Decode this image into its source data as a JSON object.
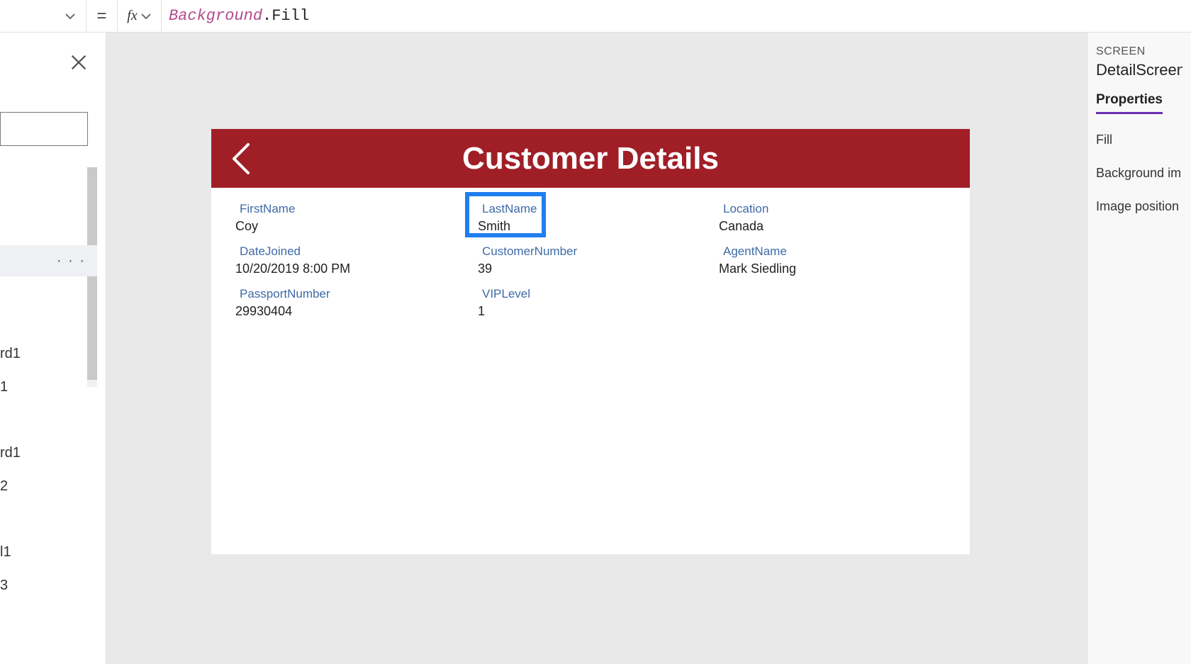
{
  "formula_bar": {
    "equals": "=",
    "fx": "fx",
    "identifier": "Background",
    "dot": ".",
    "property": "Fill"
  },
  "left_panel": {
    "selected_more": "· · ·",
    "items": [
      "rd1",
      "1",
      "rd1",
      "2",
      "l1",
      "3"
    ]
  },
  "app": {
    "title": "Customer Details",
    "fields": {
      "first_name_label": "FirstName",
      "first_name_value": "Coy",
      "last_name_label": "LastName",
      "last_name_value": "Smith",
      "location_label": "Location",
      "location_value": "Canada",
      "date_joined_label": "DateJoined",
      "date_joined_value": "10/20/2019 8:00 PM",
      "customer_number_label": "CustomerNumber",
      "customer_number_value": "39",
      "agent_name_label": "AgentName",
      "agent_name_value": "Mark Siedling",
      "passport_label": "PassportNumber",
      "passport_value": "29930404",
      "vip_label": "VIPLevel",
      "vip_value": "1"
    }
  },
  "right_panel": {
    "kind": "SCREEN",
    "name": "DetailScreen",
    "tab_properties": "Properties",
    "row_fill": "Fill",
    "row_bg_image": "Background im",
    "row_image_pos": "Image position"
  }
}
